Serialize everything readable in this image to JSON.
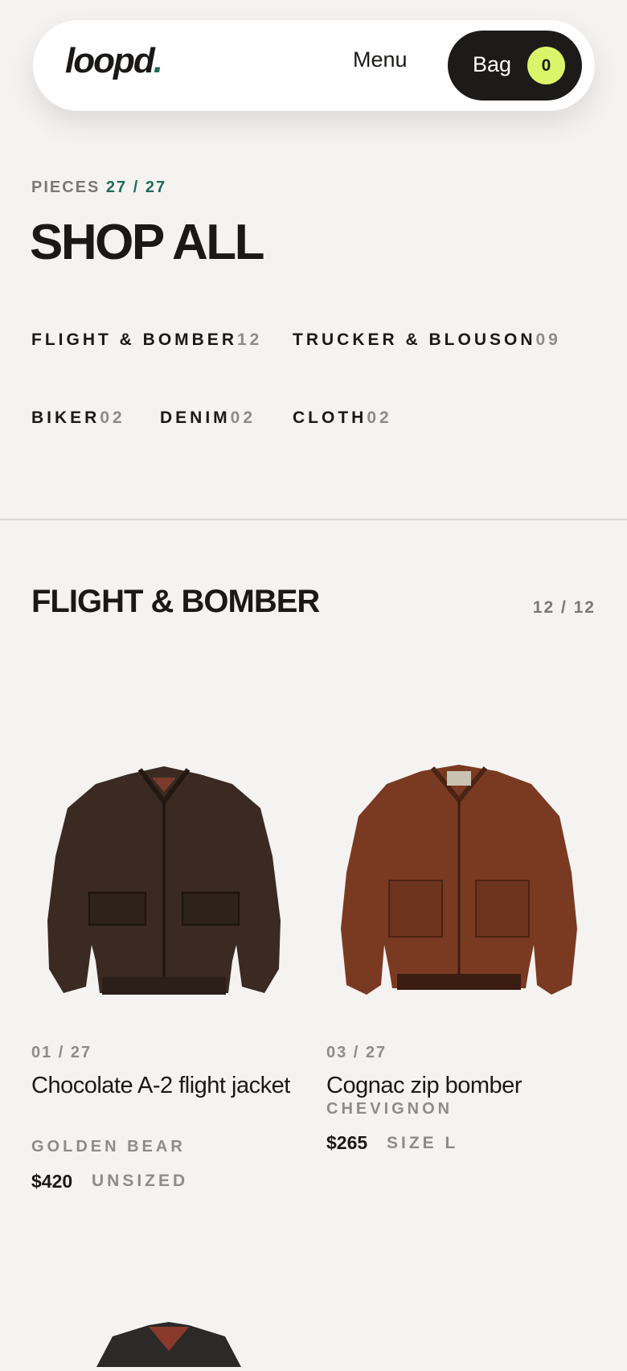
{
  "header": {
    "logo": "loopd",
    "logo_dot": ".",
    "menu_label": "Menu",
    "bag_label": "Bag",
    "bag_count": "0"
  },
  "page": {
    "pieces_label": "PIECES",
    "pieces_count": "27 / 27",
    "title": "SHOP ALL"
  },
  "filters": [
    {
      "label": "FLIGHT & BOMBER",
      "count": "12"
    },
    {
      "label": "TRUCKER & BLOUSON",
      "count": "09"
    },
    {
      "label": "BIKER",
      "count": "02"
    },
    {
      "label": "DENIM",
      "count": "02"
    },
    {
      "label": "CLOTH",
      "count": "02"
    }
  ],
  "section": {
    "title": "FLIGHT & BOMBER",
    "count": "12 / 12"
  },
  "products": [
    {
      "index": "01 / 27",
      "name": "Chocolate A-2 flight jacket",
      "brand": "GOLDEN BEAR",
      "price": "$420",
      "size": "UNSIZED",
      "color": "#3a2a22"
    },
    {
      "index": "03 / 27",
      "name": "Cognac zip bomber",
      "brand": "CHEVIGNON",
      "price": "$265",
      "size": "SIZE L",
      "color": "#7a3a22"
    }
  ],
  "colors": {
    "background": "#f4f3f1",
    "accent_green": "#1f6b5b",
    "bag_badge": "#dcf46a",
    "bag_button": "#1c1b19"
  }
}
